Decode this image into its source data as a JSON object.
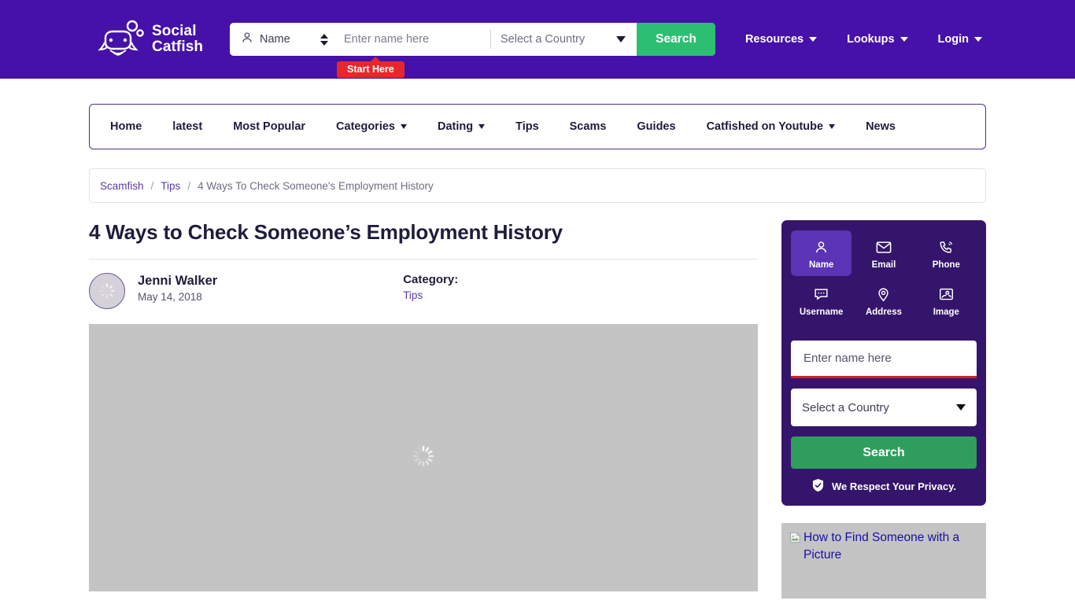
{
  "header": {
    "logo_text_line1": "Social",
    "logo_text_line2": "Catfish",
    "logo_icon": "catfish-logo-icon",
    "search": {
      "type_icon": "person-icon",
      "type_value": "Name",
      "stepper_icon": "up-down-stepper-icon",
      "name_placeholder": "Enter name here",
      "name_value": "",
      "country_value": "Select a Country",
      "country_caret_icon": "chevron-down-icon",
      "search_label": "Search",
      "start_here_badge": "Start Here"
    },
    "nav": [
      {
        "label": "Resources",
        "has_caret": true
      },
      {
        "label": "Lookups",
        "has_caret": true
      },
      {
        "label": "Login",
        "has_caret": true
      }
    ]
  },
  "subnav": [
    {
      "label": "Home",
      "has_caret": false
    },
    {
      "label": "latest",
      "has_caret": false
    },
    {
      "label": "Most Popular",
      "has_caret": false
    },
    {
      "label": "Categories",
      "has_caret": true
    },
    {
      "label": "Dating",
      "has_caret": true
    },
    {
      "label": "Tips",
      "has_caret": false
    },
    {
      "label": "Scams",
      "has_caret": false
    },
    {
      "label": "Guides",
      "has_caret": false
    },
    {
      "label": "Catfished on Youtube",
      "has_caret": true
    },
    {
      "label": "News",
      "has_caret": false
    }
  ],
  "breadcrumb": {
    "items": [
      {
        "label": "Scamfish",
        "link": true
      },
      {
        "label": "Tips",
        "link": true
      },
      {
        "label": "4 Ways To Check Someone's Employment History",
        "link": false
      }
    ],
    "separator": "/"
  },
  "article": {
    "title": "4 Ways to Check Someone’s Employment History",
    "author_name": "Jenni Walker",
    "author_date": "May 14, 2018",
    "avatar_icon": "loading-spinner-icon",
    "category_label": "Category:",
    "category_value": "Tips",
    "hero_icon": "loading-spinner-icon"
  },
  "sidebar": {
    "tabs": [
      {
        "label": "Name",
        "icon": "person-icon",
        "active": true
      },
      {
        "label": "Email",
        "icon": "envelope-icon",
        "active": false
      },
      {
        "label": "Phone",
        "icon": "phone-ring-icon",
        "active": false
      },
      {
        "label": "Username",
        "icon": "chat-bubble-icon",
        "active": false
      },
      {
        "label": "Address",
        "icon": "map-pin-icon",
        "active": false
      },
      {
        "label": "Image",
        "icon": "photo-person-icon",
        "active": false
      }
    ],
    "name_placeholder": "Enter name here",
    "name_value": "",
    "country_value": "Select a Country",
    "country_caret_icon": "chevron-down-icon",
    "search_label": "Search",
    "privacy_icon": "shield-check-icon",
    "privacy_text": "We Respect Your Privacy.",
    "promo_alt_text": "How to Find Someone with a Picture",
    "promo_icon": "broken-image-icon"
  },
  "colors": {
    "header_purple": "#4511a8",
    "widget_purple": "#35156b",
    "active_tab_purple": "#5b33b5",
    "green_button": "#2cbf72",
    "sidebar_green_button": "#2f9e5c",
    "red_badge": "#e8262d",
    "red_underline": "#cf2030",
    "link_purple": "#5b3aa8",
    "alt_text_blue": "#1a0dab",
    "placeholder_grey": "#c4c4c4"
  }
}
